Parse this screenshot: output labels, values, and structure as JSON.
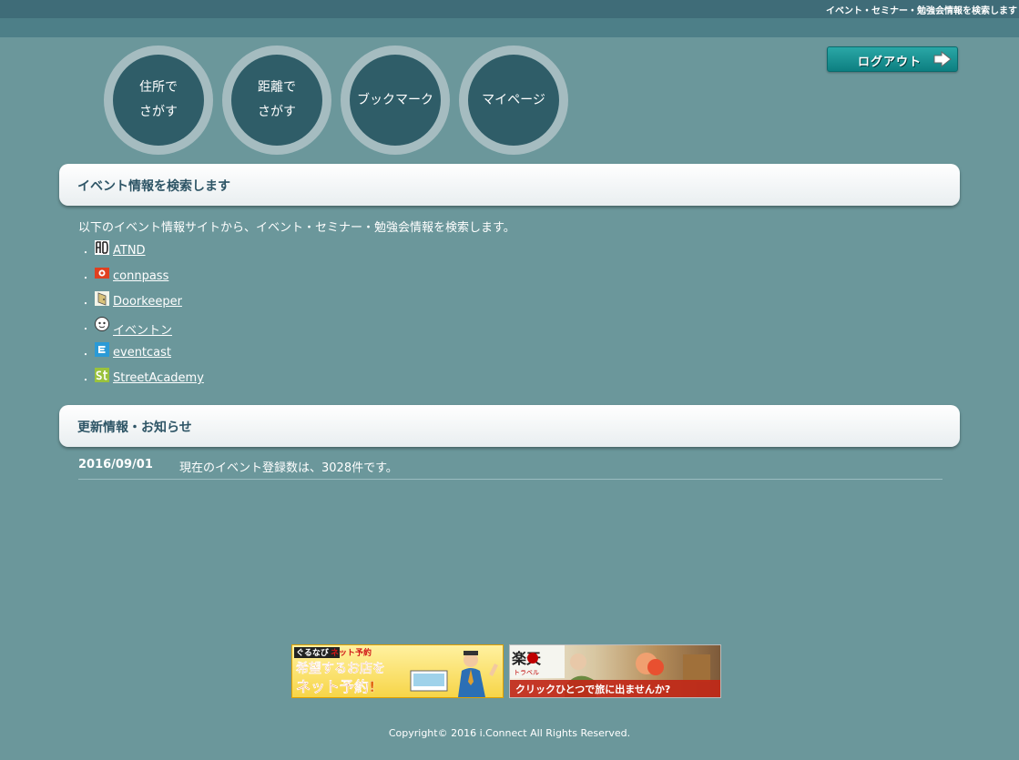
{
  "header": {
    "tagline": "イベント・セミナー・勉強会情報を検索します",
    "logout_label": "ログアウト"
  },
  "nav": {
    "items": [
      {
        "label": "住所で\nさがす"
      },
      {
        "label": "距離で\nさがす"
      },
      {
        "label": "ブックマーク"
      },
      {
        "label": "マイページ"
      }
    ]
  },
  "search_section": {
    "title": "イベント情報を検索します",
    "intro": "以下のイベント情報サイトから、イベント・セミナー・勉強会情報を検索します。",
    "sites": [
      {
        "name": "ATND",
        "icon": "atnd-icon"
      },
      {
        "name": "connpass",
        "icon": "connpass-icon"
      },
      {
        "name": "Doorkeeper",
        "icon": "doorkeeper-icon"
      },
      {
        "name": "イベントン",
        "icon": "eventon-icon"
      },
      {
        "name": "eventcast",
        "icon": "eventcast-icon"
      },
      {
        "name": "StreetAcademy",
        "icon": "streetacademy-icon"
      }
    ]
  },
  "news_section": {
    "title": "更新情報・お知らせ",
    "items": [
      {
        "date": "2016/09/01",
        "text": "現在のイベント登録数は、3028件です。"
      }
    ]
  },
  "banners": {
    "gurunavi": {
      "brand": "ぐるなび",
      "tag": "ネット予約",
      "line1": "希望するお店を",
      "line2": "ネット予約!"
    },
    "rakuten": {
      "brand": "楽天",
      "sub": "トラベル",
      "text": "クリックひとつで旅に出ませんか?"
    }
  },
  "footer": {
    "copyright": "Copyright© 2016 i.Connect All Rights Reserved."
  },
  "colors": {
    "background": "#6b979b",
    "topbar": "#3f6c78",
    "circle_inner": "#2f5d68",
    "circle_ring": "#a5bcc0",
    "logout": "#0d7f81",
    "panel_title": "#2e5566"
  }
}
